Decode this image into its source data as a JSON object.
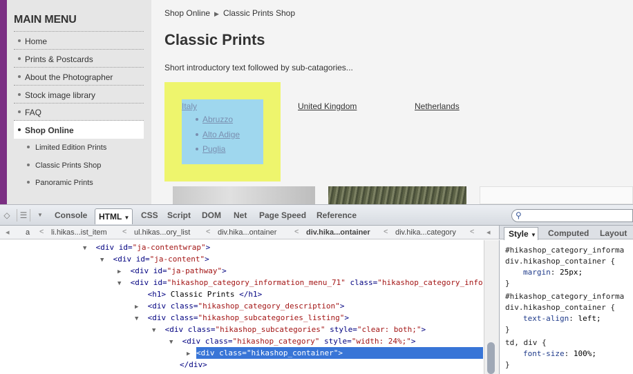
{
  "site": {
    "menu_title": "MAIN MENU",
    "menu_items": [
      "Home",
      "Prints & Postcards",
      "About the Photographer",
      "Stock image library",
      "FAQ",
      "Shop Online"
    ],
    "active_item": "Shop Online",
    "sub_items": [
      "Limited Edition Prints",
      "Classic Prints Shop",
      "Panoramic Prints"
    ],
    "breadcrumb": [
      "Shop Online",
      "Classic Prints Shop"
    ],
    "page_title": "Classic Prints",
    "intro": "Short introductory text followed by sub-catagories...",
    "categories": {
      "italy": "Italy",
      "italy_regions": [
        "Abruzzo",
        "Alto Adige",
        "Puglia"
      ],
      "uk": "United Kingdom",
      "netherlands": "Netherlands"
    },
    "colors": {
      "sidebar_accent": "#7b2f83",
      "highlight_container": "#eef56d",
      "highlight_content": "#9fd7ee"
    }
  },
  "firebug": {
    "toolbar_tabs": [
      "Console",
      "HTML",
      "CSS",
      "Script",
      "DOM",
      "Net",
      "Page Speed",
      "Reference"
    ],
    "active_tab": "HTML",
    "path": [
      "a",
      "li.hikas...ist_item",
      "ul.hikas...ory_list",
      "div.hika...ontainer",
      "div.hika...ontainer",
      "div.hika...category"
    ],
    "side_tabs": [
      "Style",
      "Computed",
      "Layout"
    ],
    "tree": [
      {
        "t": "<div ",
        "a": "id",
        "v": "\"ja-contentwrap\"",
        "e": ">"
      },
      {
        "t": "<div ",
        "a": "id",
        "v": "\"ja-content\"",
        "e": ">"
      },
      {
        "t": "<div ",
        "a": "id",
        "v": "\"ja-pathway\"",
        "e": ">"
      },
      {
        "t": "<div ",
        "a": "id",
        "v": "\"hikashop_category_information_menu_71\"",
        "a2": " class",
        "v2": "\"hikashop_category_infor",
        "e": ""
      },
      {
        "t": "<h1>",
        "x": " Classic Prints ",
        "e": "</h1>"
      },
      {
        "t": "<div ",
        "a": "class",
        "v": "\"hikashop_category_description\"",
        "e": ">"
      },
      {
        "t": "<div ",
        "a": "class",
        "v": "\"hikashop_subcategories_listing\"",
        "e": ">"
      },
      {
        "t": "<div ",
        "a": "class",
        "v": "\"hikashop_subcategories\"",
        "a2": " style",
        "v2": "\"clear: both;\"",
        "e": ">"
      },
      {
        "t": "<div ",
        "a": "class",
        "v": "\"hikashop_category\"",
        "a2": " style",
        "v2": "\"width: 24%;\"",
        "e": ">"
      },
      {
        "t": "<div ",
        "a": "class",
        "v": "\"hikashop_container\"",
        "e": ">"
      },
      {
        "t": "</div>",
        "e": ""
      }
    ],
    "styles": [
      {
        "sel1": "#hikashop_category_informa",
        "sel2": "div.hikashop_container {",
        "prop": "margin",
        "val": "25px;"
      },
      {
        "sel1": "#hikashop_category_informa",
        "sel2": "div.hikashop_container {",
        "prop": "text-align",
        "val": "left;"
      },
      {
        "sel1": "td, div {",
        "sel2": "",
        "prop": "font-size",
        "val": "100%;"
      }
    ]
  }
}
